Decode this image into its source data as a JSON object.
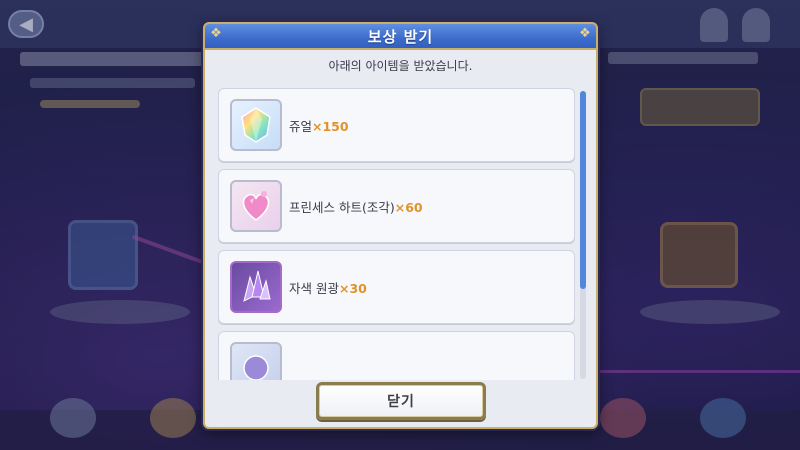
{
  "dialog": {
    "title": "보상 받기",
    "subtitle": "아래의 아이템을 받았습니다.",
    "close_label": "닫기"
  },
  "rewards": [
    {
      "name": "쥬얼",
      "qty": "×150",
      "icon": "jewel-icon"
    },
    {
      "name": "프린세스 하트(조각)",
      "qty": "×60",
      "icon": "princess-heart-icon"
    },
    {
      "name": "자색 원광",
      "qty": "×30",
      "icon": "purple-ore-icon"
    },
    {
      "name": "",
      "qty": "",
      "icon": "reward-item-icon"
    }
  ],
  "colors": {
    "header": "#3d6ccc",
    "qty": "#e0932a",
    "scroll_thumb": "#4f86de",
    "frame_gold": "#c8b06a"
  }
}
